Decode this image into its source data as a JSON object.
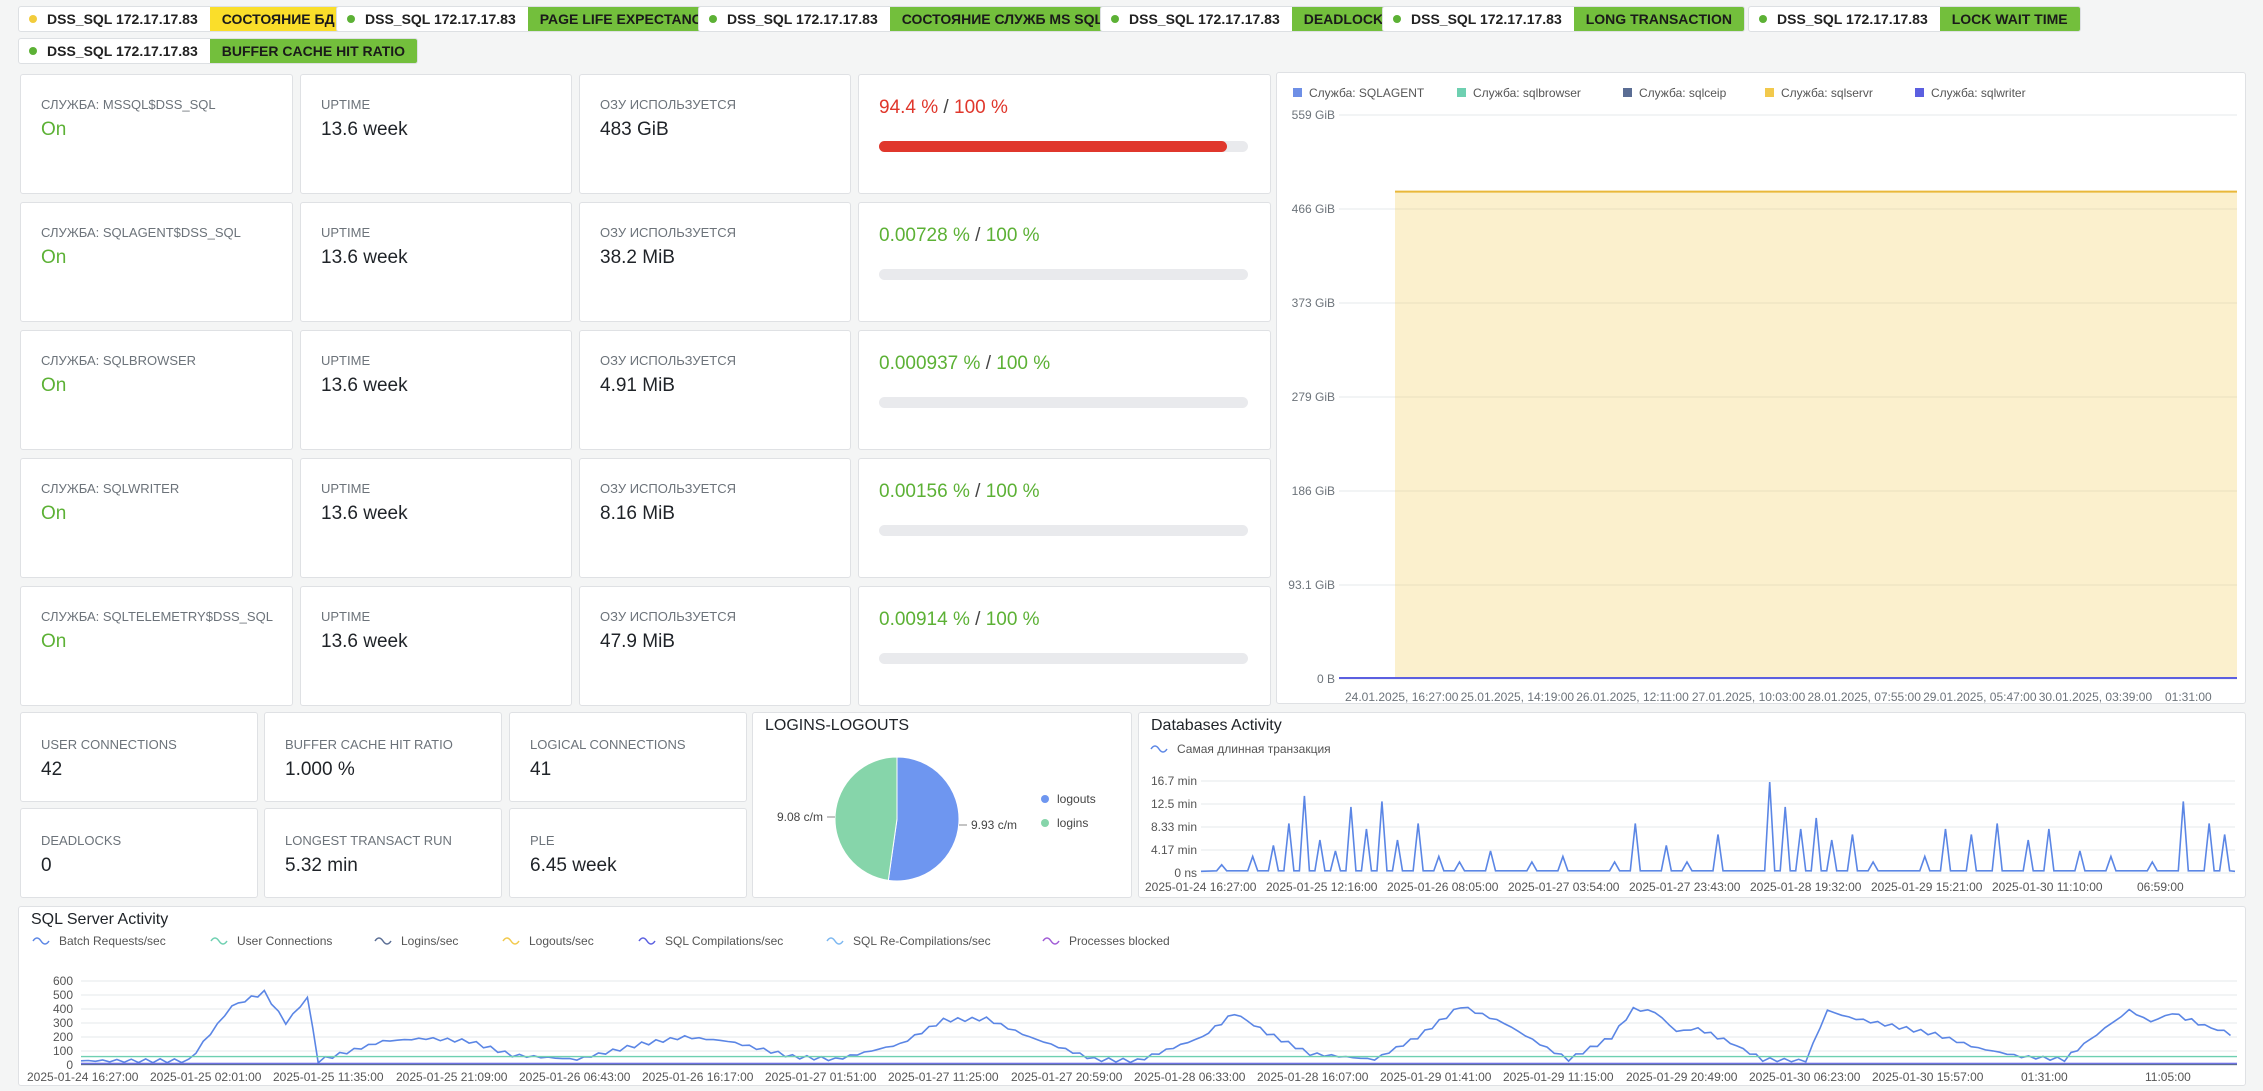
{
  "tags": [
    {
      "host": "DSS_SQL 172.17.17.83",
      "label": "СОСТОЯНИЕ БД",
      "dot": "#f2cc3c",
      "bg": "#fade2a"
    },
    {
      "host": "DSS_SQL 172.17.17.83",
      "label": "PAGE LIFE EXPECTANCY",
      "dot": "#5cb135",
      "bg": "#73bf3c"
    },
    {
      "host": "DSS_SQL 172.17.17.83",
      "label": "СОСТОЯНИЕ СЛУЖБ MS SQL",
      "dot": "#5cb135",
      "bg": "#73bf3c"
    },
    {
      "host": "DSS_SQL 172.17.17.83",
      "label": "DEADLOCK",
      "dot": "#5cb135",
      "bg": "#73bf3c"
    },
    {
      "host": "DSS_SQL 172.17.17.83",
      "label": "LONG TRANSACTION",
      "dot": "#5cb135",
      "bg": "#73bf3c"
    },
    {
      "host": "DSS_SQL 172.17.17.83",
      "label": "LOCK WAIT TIME",
      "dot": "#5cb135",
      "bg": "#73bf3c"
    },
    {
      "host": "DSS_SQL 172.17.17.83",
      "label": "BUFFER CACHE HIT RATIO",
      "dot": "#5cb135",
      "bg": "#73bf3c"
    }
  ],
  "services": [
    {
      "name": "СЛУЖБА: MSSQL$DSS_SQL",
      "status": "On",
      "uptime_label": "UPTIME",
      "uptime": "13.6 week",
      "ram_label": "ОЗУ ИСПОЛЬЗУЕТСЯ",
      "ram": "483 GiB",
      "pct": "94.4 %",
      "max": "100 %",
      "level": 94.4,
      "pct_color": "#e0372c"
    },
    {
      "name": "СЛУЖБА: SQLAGENT$DSS_SQL",
      "status": "On",
      "uptime_label": "UPTIME",
      "uptime": "13.6 week",
      "ram_label": "ОЗУ ИСПОЛЬЗУЕТСЯ",
      "ram": "38.2 MiB",
      "pct": "0.00728 %",
      "max": "100 %",
      "level": 0.00728,
      "pct_color": "#5cb135"
    },
    {
      "name": "СЛУЖБА: SQLBROWSER",
      "status": "On",
      "uptime_label": "UPTIME",
      "uptime": "13.6 week",
      "ram_label": "ОЗУ ИСПОЛЬЗУЕТСЯ",
      "ram": "4.91 MiB",
      "pct": "0.000937 %",
      "max": "100 %",
      "level": 0.000937,
      "pct_color": "#5cb135"
    },
    {
      "name": "СЛУЖБА: SQLWRITER",
      "status": "On",
      "uptime_label": "UPTIME",
      "uptime": "13.6 week",
      "ram_label": "ОЗУ ИСПОЛЬЗУЕТСЯ",
      "ram": "8.16 MiB",
      "pct": "0.00156 %",
      "max": "100 %",
      "level": 0.00156,
      "pct_color": "#5cb135"
    },
    {
      "name": "СЛУЖБА: SQLTELEMETRY$DSS_SQL",
      "status": "On",
      "uptime_label": "UPTIME",
      "uptime": "13.6 week",
      "ram_label": "ОЗУ ИСПОЛЬЗУЕТСЯ",
      "ram": "47.9 MiB",
      "pct": "0.00914 %",
      "max": "100 %",
      "level": 0.00914,
      "pct_color": "#5cb135"
    }
  ],
  "stats": [
    {
      "label": "USER CONNECTIONS",
      "value": "42"
    },
    {
      "label": "BUFFER CACHE HIT RATIO",
      "value": "1.000 %"
    },
    {
      "label": "LOGICAL CONNECTIONS",
      "value": "41"
    },
    {
      "label": "DEADLOCKS",
      "value": "0"
    },
    {
      "label": "LONGEST TRANSACT RUN",
      "value": "5.32 min"
    },
    {
      "label": "PLE",
      "value": "6.45 week"
    }
  ],
  "colors": {
    "green": "#5cb135",
    "red": "#e0372c",
    "tag_green": "#73bf3c",
    "tag_yellow": "#fade2a"
  },
  "chart_data": [
    {
      "type": "area",
      "legend": [
        "Служба: SQLAGENT",
        "Служба: sqlbrowser",
        "Служба: sqlceip",
        "Служба: sqlservr",
        "Служба: sqlwriter"
      ],
      "legend_colors": [
        "#6e8fe6",
        "#6ed0b1",
        "#5a6d94",
        "#f2c94c",
        "#5b5fe0"
      ],
      "legend_placement": "top-left",
      "y_ticks": [
        "559 GiB",
        "466 GiB",
        "373 GiB",
        "279 GiB",
        "186 GiB",
        "93.1 GiB",
        "0 B"
      ],
      "x_ticks": [
        "24.01.2025, 16:27:00",
        "25.01.2025, 14:19:00",
        "26.01.2025, 12:11:00",
        "27.01.2025, 10:03:00",
        "28.01.2025, 07:55:00",
        "29.01.2025, 05:47:00",
        "30.01.2025, 03:39:00",
        "01:31:00"
      ],
      "ylim": [
        0,
        559
      ],
      "series": [
        {
          "name": "Служба: sqlservr",
          "start_index": 1,
          "constant": 483
        },
        {
          "name": "Служба: sqlwriter",
          "start_index": 0,
          "constant": 0.008
        }
      ],
      "grid": true
    },
    {
      "type": "pie",
      "title": "LOGINS-LOGOUTS",
      "slices": [
        {
          "name": "logouts",
          "value": 9.93,
          "label": "9.93  c/m",
          "color": "#6e96f0"
        },
        {
          "name": "logins",
          "value": 9.08,
          "label": "9.08  c/m",
          "color": "#86d5aa"
        }
      ],
      "legend_placement": "right"
    },
    {
      "type": "line",
      "title": "Databases Activity",
      "legend": [
        "Самая длинная транзакция"
      ],
      "y_ticks": [
        "16.7 min",
        "12.5 min",
        "8.33 min",
        "4.17 min",
        "0 ns"
      ],
      "ylim": [
        0,
        16.7
      ],
      "x_ticks": [
        "2025-01-24 16:27:00",
        "2025-01-25 12:16:00",
        "2025-01-26 08:05:00",
        "2025-01-27 03:54:00",
        "2025-01-27 23:43:00",
        "2025-01-28 19:32:00",
        "2025-01-29 15:21:00",
        "2025-01-30 11:10:00",
        "06:59:00"
      ],
      "spikes": [
        [
          0.02,
          1.5
        ],
        [
          0.05,
          3
        ],
        [
          0.07,
          5
        ],
        [
          0.085,
          9
        ],
        [
          0.1,
          14
        ],
        [
          0.115,
          6
        ],
        [
          0.13,
          4
        ],
        [
          0.145,
          12
        ],
        [
          0.16,
          8
        ],
        [
          0.175,
          13
        ],
        [
          0.19,
          6
        ],
        [
          0.21,
          9
        ],
        [
          0.23,
          3
        ],
        [
          0.25,
          2
        ],
        [
          0.28,
          4
        ],
        [
          0.32,
          2
        ],
        [
          0.35,
          3
        ],
        [
          0.4,
          2
        ],
        [
          0.42,
          9
        ],
        [
          0.45,
          5
        ],
        [
          0.47,
          2
        ],
        [
          0.5,
          7
        ],
        [
          0.55,
          16.5
        ],
        [
          0.565,
          12
        ],
        [
          0.58,
          8
        ],
        [
          0.595,
          10
        ],
        [
          0.61,
          6
        ],
        [
          0.63,
          7
        ],
        [
          0.65,
          2
        ],
        [
          0.7,
          3
        ],
        [
          0.72,
          8
        ],
        [
          0.745,
          7
        ],
        [
          0.77,
          9
        ],
        [
          0.8,
          6
        ],
        [
          0.82,
          8
        ],
        [
          0.85,
          4
        ],
        [
          0.88,
          3
        ],
        [
          0.92,
          2
        ],
        [
          0.95,
          13
        ],
        [
          0.975,
          9
        ],
        [
          0.99,
          7
        ]
      ],
      "color": "#5b86e5",
      "grid": true
    },
    {
      "type": "line",
      "title": "SQL Server Activity",
      "legend": [
        "Batch Requests/sec",
        "User Connections",
        "Logins/sec",
        "Logouts/sec",
        "SQL Compilations/sec",
        "SQL Re-Compilations/sec",
        "Processes blocked"
      ],
      "legend_colors": [
        "#5b86e5",
        "#6ed0b1",
        "#5a6d94",
        "#f2c94c",
        "#5b5fe0",
        "#7cb7f0",
        "#a05bd6"
      ],
      "y_ticks": [
        "600",
        "500",
        "400",
        "300",
        "200",
        "100",
        "0"
      ],
      "ylim": [
        0,
        600
      ],
      "x_ticks": [
        "2025-01-24 16:27:00",
        "2025-01-25 02:01:00",
        "2025-01-25 11:35:00",
        "2025-01-25 21:09:00",
        "2025-01-26 06:43:00",
        "2025-01-26 16:17:00",
        "2025-01-27 01:51:00",
        "2025-01-27 11:25:00",
        "2025-01-27 20:59:00",
        "2025-01-28 06:33:00",
        "2025-01-28 16:07:00",
        "2025-01-29 01:41:00",
        "2025-01-29 11:15:00",
        "2025-01-29 20:49:00",
        "2025-01-30 06:23:00",
        "2025-01-30 15:57:00",
        "01:31:00",
        "11:05:00"
      ],
      "batch_requests": [
        [
          0,
          30
        ],
        [
          0.05,
          30
        ],
        [
          0.07,
          420
        ],
        [
          0.085,
          520
        ],
        [
          0.095,
          300
        ],
        [
          0.105,
          480
        ],
        [
          0.11,
          30
        ],
        [
          0.14,
          170
        ],
        [
          0.16,
          190
        ],
        [
          0.18,
          170
        ],
        [
          0.2,
          70
        ],
        [
          0.23,
          40
        ],
        [
          0.26,
          150
        ],
        [
          0.28,
          200
        ],
        [
          0.3,
          170
        ],
        [
          0.33,
          60
        ],
        [
          0.35,
          40
        ],
        [
          0.38,
          150
        ],
        [
          0.4,
          320
        ],
        [
          0.42,
          330
        ],
        [
          0.44,
          200
        ],
        [
          0.47,
          40
        ],
        [
          0.49,
          30
        ],
        [
          0.52,
          200
        ],
        [
          0.535,
          370
        ],
        [
          0.55,
          230
        ],
        [
          0.57,
          80
        ],
        [
          0.6,
          40
        ],
        [
          0.62,
          200
        ],
        [
          0.64,
          420
        ],
        [
          0.66,
          300
        ],
        [
          0.68,
          120
        ],
        [
          0.69,
          40
        ],
        [
          0.71,
          200
        ],
        [
          0.72,
          400
        ],
        [
          0.73,
          380
        ],
        [
          0.74,
          240
        ],
        [
          0.75,
          260
        ],
        [
          0.765,
          160
        ],
        [
          0.78,
          40
        ],
        [
          0.8,
          30
        ],
        [
          0.81,
          390
        ],
        [
          0.82,
          340
        ],
        [
          0.84,
          280
        ],
        [
          0.86,
          220
        ],
        [
          0.88,
          120
        ],
        [
          0.9,
          60
        ],
        [
          0.92,
          40
        ],
        [
          0.935,
          220
        ],
        [
          0.95,
          390
        ],
        [
          0.96,
          310
        ],
        [
          0.97,
          370
        ],
        [
          0.985,
          280
        ],
        [
          1.0,
          210
        ]
      ],
      "user_connections": 60,
      "grid": true
    }
  ]
}
